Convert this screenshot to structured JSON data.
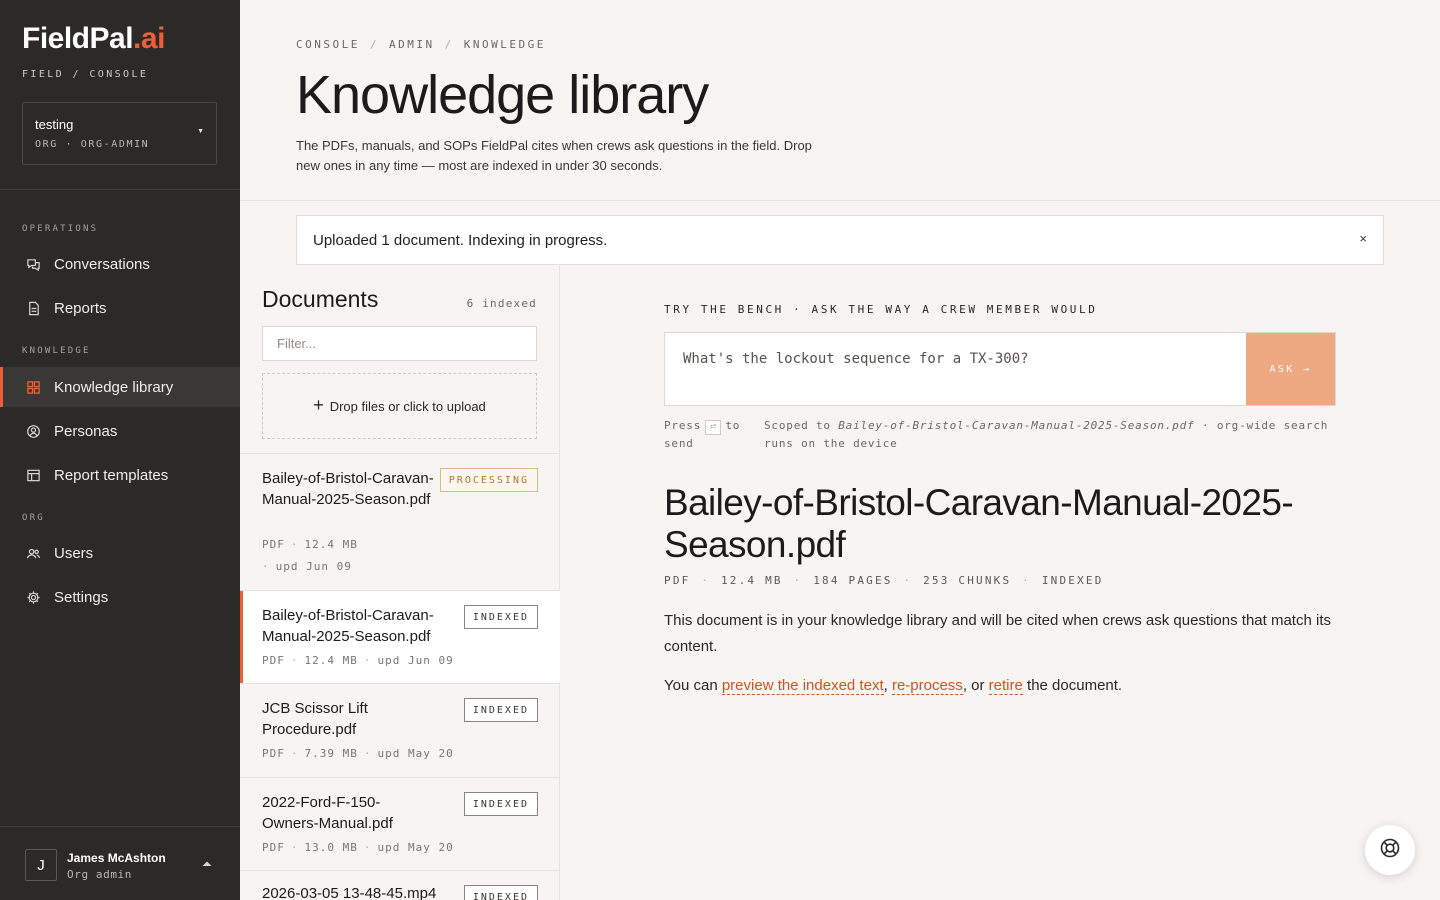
{
  "brand": {
    "name_main": "FieldPal",
    "name_accent": ".ai",
    "subtitle": "FIELD / CONSOLE",
    "accent_color": "#e8613a"
  },
  "org": {
    "name": "testing",
    "role": "ORG · ORG-ADMIN"
  },
  "sidebar": {
    "sections": [
      {
        "label": "OPERATIONS",
        "items": [
          {
            "label": "Conversations",
            "icon": "chat-icon"
          },
          {
            "label": "Reports",
            "icon": "document-icon"
          }
        ]
      },
      {
        "label": "KNOWLEDGE",
        "items": [
          {
            "label": "Knowledge library",
            "icon": "library-icon",
            "active": true
          },
          {
            "label": "Personas",
            "icon": "persona-icon"
          },
          {
            "label": "Report templates",
            "icon": "template-icon"
          }
        ]
      },
      {
        "label": "ORG",
        "items": [
          {
            "label": "Users",
            "icon": "users-icon"
          },
          {
            "label": "Settings",
            "icon": "gear-icon"
          }
        ]
      }
    ]
  },
  "user": {
    "initial": "J",
    "name": "James McAshton",
    "role": "Org admin"
  },
  "breadcrumb": [
    "CONSOLE",
    "ADMIN",
    "KNOWLEDGE"
  ],
  "page": {
    "title": "Knowledge library",
    "description": "The PDFs, manuals, and SOPs FieldPal cites when crews ask questions in the field. Drop new ones in any time — most are indexed in under 30 seconds."
  },
  "alert": {
    "message": "Uploaded 1 document. Indexing in progress.",
    "close": "×"
  },
  "documents": {
    "heading": "Documents",
    "count": "6 indexed",
    "filter_placeholder": "Filter...",
    "dropzone": "Drop files or click to upload",
    "items": [
      {
        "name": "Bailey-of-Bristol-Caravan-Manual-2025-Season.pdf",
        "status": "PROCESSING",
        "type": "PDF",
        "size": "12.4 MB",
        "updated": "upd Jun 09"
      },
      {
        "name": "Bailey-of-Bristol-Caravan-Manual-2025-Season.pdf",
        "status": "INDEXED",
        "type": "PDF",
        "size": "12.4 MB",
        "updated": "upd Jun 09",
        "selected": true
      },
      {
        "name": "JCB Scissor Lift Procedure.pdf",
        "status": "INDEXED",
        "type": "PDF",
        "size": "7.39 MB",
        "updated": "upd May 20"
      },
      {
        "name": "2022-Ford-F-150-Owners-Manual.pdf",
        "status": "INDEXED",
        "type": "PDF",
        "size": "13.0 MB",
        "updated": "upd May 20"
      },
      {
        "name": "2026-03-05 13-48-45.mp4",
        "status": "INDEXED"
      }
    ]
  },
  "bench": {
    "label": "TRY THE BENCH · ASK THE WAY A CREW MEMBER WOULD",
    "placeholder": "What's the lockout sequence for a TX-300?",
    "button": "ASK →",
    "press": "Press",
    "key": "⏎",
    "to_send": "to",
    "send": "send",
    "scope_prefix": "Scoped to",
    "scope_file": "Bailey-of-Bristol-Caravan-Manual-2025-Season.pdf",
    "scope_suffix": "· org-wide search",
    "scope_line2": "runs on the device"
  },
  "detail": {
    "title": "Bailey-of-Bristol-Caravan-Manual-2025-Season.pdf",
    "meta": [
      "PDF",
      "12.4 MB",
      "184 PAGES",
      "253 CHUNKS",
      "INDEXED"
    ],
    "description": "This document is in your knowledge library and will be cited when crews ask questions that match its content.",
    "actions_prefix": "You can",
    "action_preview": "preview the indexed text",
    "action_reprocess": "re-process",
    "action_or": "or",
    "action_retire": "retire",
    "actions_suffix": "the document."
  }
}
